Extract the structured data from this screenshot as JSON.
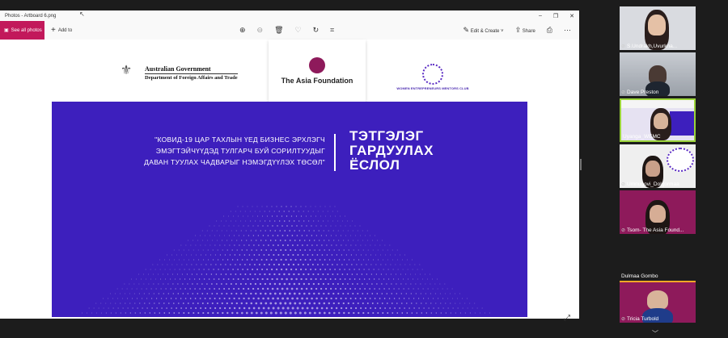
{
  "window": {
    "title": "Photos - Artboard 6.png",
    "controls": [
      "–",
      "❐",
      "✕"
    ]
  },
  "toolbar": {
    "see_all": "See all photos",
    "add_to": "Add to",
    "edit_create": "Edit & Create",
    "share": "Share"
  },
  "slide": {
    "gov_line1": "Australian Government",
    "gov_line2": "Department of Foreign Affairs and Trade",
    "taf_name": "The Asia Foundation",
    "wemc_name": "WOMEN ENTREPRENEURS MENTORS CLUB",
    "quote_lines": [
      "\"КОВИД-19 ЦАР ТАХЛЫН ҮЕД БИЗНЕС ЭРХЛЭГЧ",
      "ЭМЭГТЭЙЧҮҮДЭД ТУЛГАРЧ БУЙ СОРИЛТУУДЫГ",
      "ДАВАН ТУУЛАХ ЧАДВАРЫГ НЭМЭГДҮҮЛЭХ ТӨСӨЛ\""
    ],
    "heading_lines": [
      "ТЭТГЭЛЭГ",
      "ГАРДУУЛАХ",
      "ЁСЛОЛ"
    ],
    "banner_color": "#3d1fbd"
  },
  "participants": [
    {
      "name": "S.Undrakh,Uvurkha...",
      "muted": true
    },
    {
      "name": "Dave Preston",
      "muted": true
    },
    {
      "name": "Uyanga_WEMC",
      "muted": false
    },
    {
      "name": "Umnugovi_Dolgormaa",
      "muted": true
    },
    {
      "name": "Tsom- The Asia Found...",
      "muted": true
    },
    {
      "name": "Dulmaa Gombo",
      "muted": false
    },
    {
      "name": "Tricia Turbold",
      "muted": true
    }
  ],
  "colors": {
    "accent": "#c2185b",
    "active_speaker": "#9bd43a"
  }
}
